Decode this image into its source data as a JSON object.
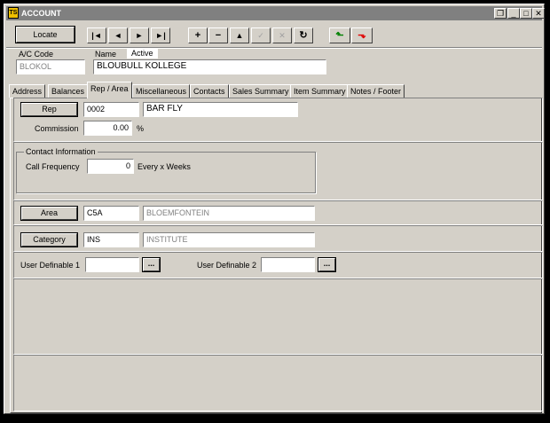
{
  "window": {
    "title": "ACCOUNT",
    "app_icon_text": "TS",
    "controls": [
      "❐",
      "_",
      "□",
      "✕"
    ]
  },
  "toolbar": {
    "locate_label": "Locate",
    "nav": [
      "|◄",
      "◄",
      "►",
      "►|"
    ],
    "edit": [
      "+",
      "−",
      "▲",
      "✓",
      "✕",
      "↻"
    ],
    "accept_symbol": "⬑",
    "cancel_symbol": "⬎",
    "accent_green": "#008000",
    "accent_red": "#e00000"
  },
  "header": {
    "ac_code_label": "A/C Code",
    "ac_code_value": "BLOKOL",
    "name_label": "Name",
    "status": "Active",
    "name_value": "BLOUBULL KOLLEGE"
  },
  "tabs": [
    {
      "label": "Address"
    },
    {
      "label": "Balances"
    },
    {
      "label": "Rep / Area"
    },
    {
      "label": "Miscellaneous"
    },
    {
      "label": "Contacts"
    },
    {
      "label": "Sales Summary"
    },
    {
      "label": "Item Summary"
    },
    {
      "label": "Notes / Footer"
    }
  ],
  "active_tab": "Rep / Area",
  "rep": {
    "button_label": "Rep",
    "code": "0002",
    "name": "BAR FLY",
    "commission_label": "Commission",
    "commission_value": "0.00",
    "commission_unit": "%"
  },
  "contact": {
    "group_title": "Contact Information",
    "call_frequency_label": "Call Frequency",
    "call_frequency_value": "0",
    "call_frequency_suffix": "Every x Weeks"
  },
  "area": {
    "button_label": "Area",
    "code": "C5A",
    "name": "BLOEMFONTEIN"
  },
  "category": {
    "button_label": "Category",
    "code": "INS",
    "name": "INSTITUTE"
  },
  "user_definable": {
    "label_1": "User Definable 1",
    "value_1": "",
    "label_2": "User Definable 2",
    "value_2": "",
    "browse_label": "..."
  }
}
